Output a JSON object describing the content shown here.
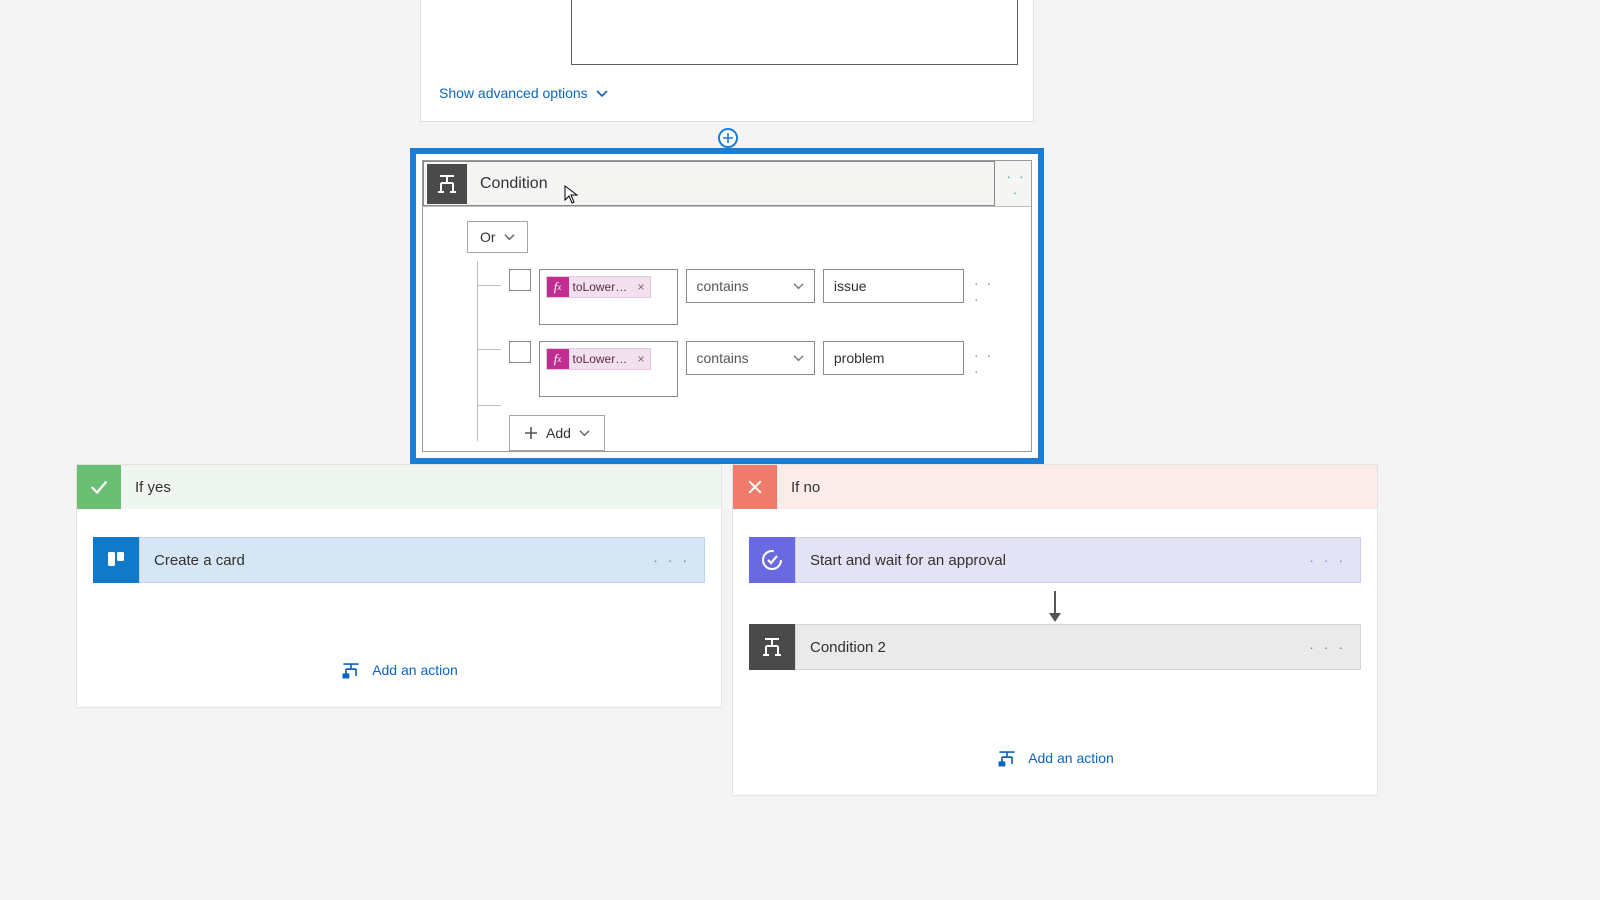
{
  "topCard": {
    "advancedLink": "Show advanced options"
  },
  "condition": {
    "title": "Condition",
    "groupOperator": "Or",
    "rows": [
      {
        "token": "toLower(…",
        "operator": "contains",
        "value": "issue"
      },
      {
        "token": "toLower(…",
        "operator": "contains",
        "value": "problem"
      }
    ],
    "addLabel": "Add"
  },
  "branches": {
    "yes": {
      "title": "If yes",
      "actions": [
        {
          "title": "Create a card",
          "iconType": "trello"
        }
      ],
      "addActionLabel": "Add an action"
    },
    "no": {
      "title": "If no",
      "actions": [
        {
          "title": "Start and wait for an approval",
          "iconType": "approval"
        },
        {
          "title": "Condition 2",
          "iconType": "condition"
        }
      ],
      "addActionLabel": "Add an action"
    }
  }
}
